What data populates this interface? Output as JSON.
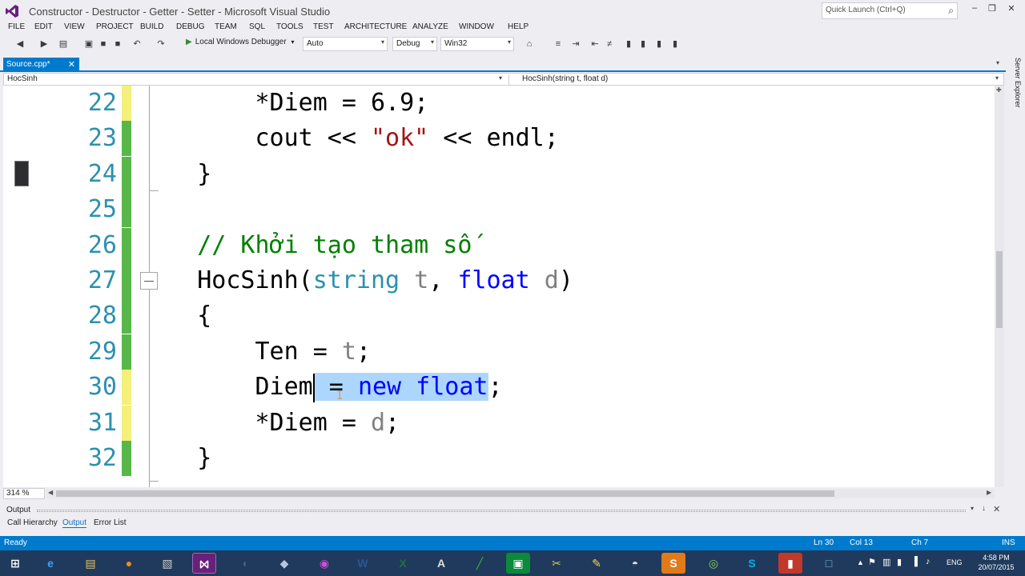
{
  "window": {
    "title": "Constructor - Destructor - Getter - Setter - Microsoft Visual Studio",
    "quick_launch_placeholder": "Quick Launch (Ctrl+Q)"
  },
  "menu": [
    "FILE",
    "EDIT",
    "VIEW",
    "PROJECT",
    "BUILD",
    "DEBUG",
    "TEAM",
    "SQL",
    "TOOLS",
    "TEST",
    "ARCHITECTURE",
    "ANALYZE",
    "WINDOW",
    "HELP"
  ],
  "toolbar": {
    "run_label": "Local Windows Debugger",
    "solution_config_1": "Auto",
    "solution_config_2": "Debug",
    "platform": "Win32"
  },
  "tabs": {
    "active_file": "Source.cpp*"
  },
  "navbar": {
    "scope": "HocSinh",
    "member": "HocSinh(string t, float d)"
  },
  "right_rail": {
    "label": "Server Explorer"
  },
  "editor": {
    "lines": [
      {
        "num": "22",
        "parts": [
          {
            "t": "        *Diem = 6.9;",
            "c": ""
          }
        ]
      },
      {
        "num": "23",
        "parts": [
          {
            "t": "        cout << ",
            "c": ""
          },
          {
            "t": "\"ok\"",
            "c": "str"
          },
          {
            "t": " << endl;",
            "c": ""
          }
        ]
      },
      {
        "num": "24",
        "parts": [
          {
            "t": "    }",
            "c": ""
          }
        ]
      },
      {
        "num": "25",
        "parts": [
          {
            "t": "",
            "c": ""
          }
        ]
      },
      {
        "num": "26",
        "parts": [
          {
            "t": "    // Khởi tạo tham số",
            "c": "cmt"
          }
        ]
      },
      {
        "num": "27",
        "parts": [
          {
            "t": "    HocSinh(",
            "c": ""
          },
          {
            "t": "string",
            "c": "ty"
          },
          {
            "t": " ",
            "c": ""
          },
          {
            "t": "t",
            "c": "prm"
          },
          {
            "t": ", ",
            "c": ""
          },
          {
            "t": "float",
            "c": "kw"
          },
          {
            "t": " ",
            "c": ""
          },
          {
            "t": "d",
            "c": "prm"
          },
          {
            "t": ")",
            "c": ""
          }
        ]
      },
      {
        "num": "28",
        "parts": [
          {
            "t": "    {",
            "c": ""
          }
        ]
      },
      {
        "num": "29",
        "parts": [
          {
            "t": "        Ten = ",
            "c": ""
          },
          {
            "t": "t",
            "c": "prm"
          },
          {
            "t": ";",
            "c": ""
          }
        ]
      },
      {
        "num": "30",
        "parts": [
          {
            "t": "        Diem",
            "c": ""
          },
          {
            "t": " = ",
            "c": "sel"
          },
          {
            "t": "new float",
            "c": "sel kw"
          },
          {
            "t": ";",
            "c": ""
          }
        ]
      },
      {
        "num": "31",
        "parts": [
          {
            "t": "        *Diem = ",
            "c": ""
          },
          {
            "t": "d",
            "c": "prm"
          },
          {
            "t": ";",
            "c": ""
          }
        ]
      },
      {
        "num": "32",
        "parts": [
          {
            "t": "    }",
            "c": ""
          }
        ]
      }
    ],
    "zoom": "314 %"
  },
  "output": {
    "title": "Output",
    "tabs": [
      "Call Hierarchy",
      "Output",
      "Error List"
    ]
  },
  "status": {
    "state": "Ready",
    "ln": "Ln 30",
    "col": "Col 13",
    "ch": "Ch 7",
    "mode": "INS"
  },
  "tray": {
    "lang": "ENG",
    "time": "4:58 PM",
    "date": "20/07/2015"
  },
  "colors": {
    "accent": "#007acc",
    "changed_saved": "#57b849",
    "changed_unsaved": "#f4f07a"
  }
}
